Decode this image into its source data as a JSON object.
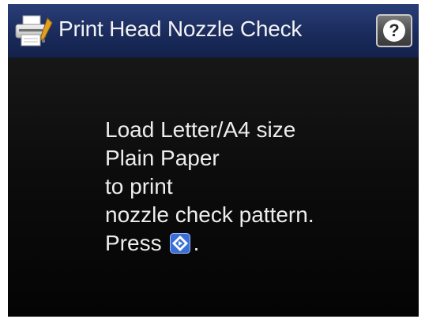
{
  "header": {
    "title": "Print Head Nozzle Check",
    "printer_icon": "printer-icon",
    "help_icon": "question-mark-icon",
    "help_label": "?"
  },
  "message": {
    "lines": [
      "Load Letter/A4 size",
      "Plain Paper",
      "to print",
      "nozzle check pattern."
    ],
    "press_prefix": "Press",
    "press_suffix": ".",
    "start_icon": "start-button-icon"
  },
  "colors": {
    "title_bar": "#1a2b5c",
    "background": "#0c0c0c",
    "text": "#ededed",
    "start_icon": "#3b6fd8"
  }
}
